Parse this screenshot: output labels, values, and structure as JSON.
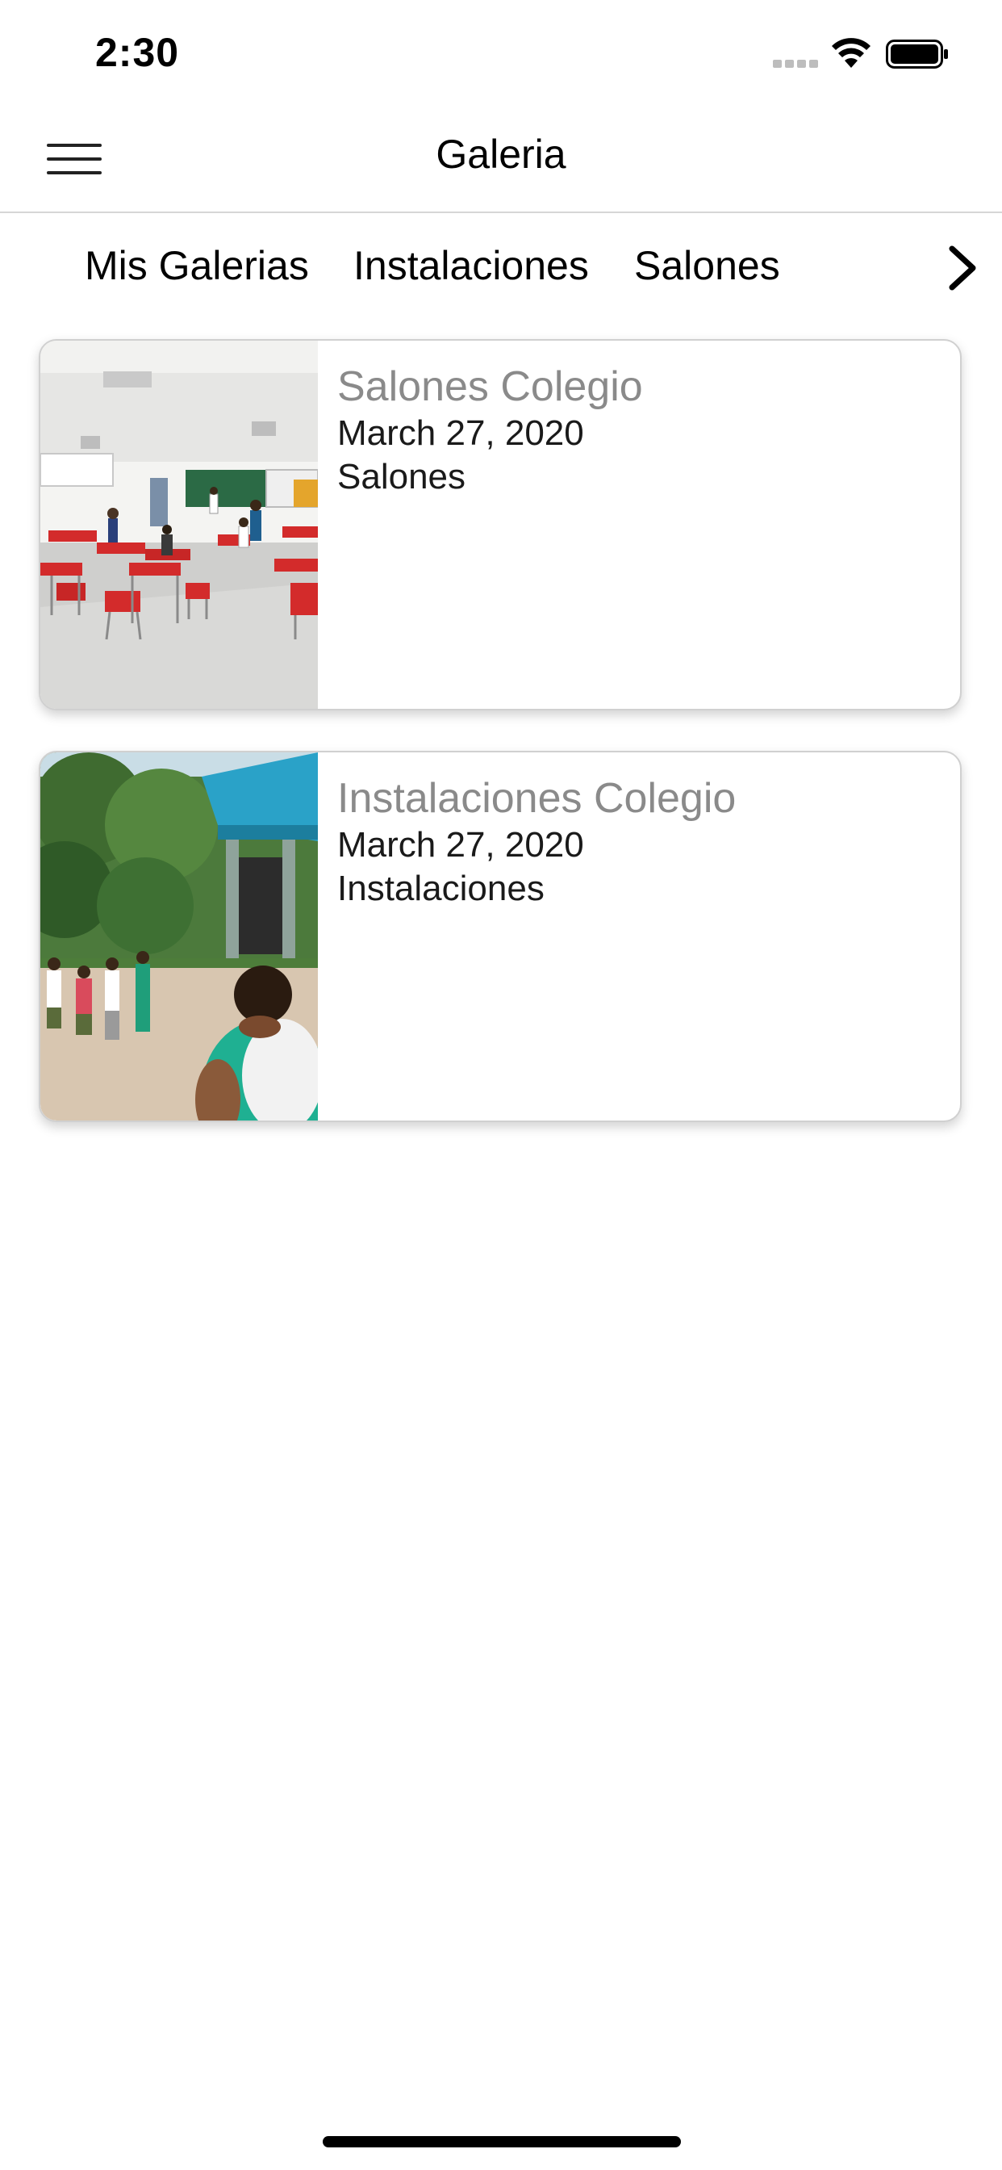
{
  "status_bar": {
    "time": "2:30"
  },
  "nav": {
    "title": "Galeria",
    "menu_icon": "hamburger-menu-icon"
  },
  "tabs": [
    {
      "label": "Mis Galerias"
    },
    {
      "label": "Instalaciones"
    },
    {
      "label": "Salones"
    }
  ],
  "tabs_next_icon": "chevron-right-icon",
  "galleries": [
    {
      "title": "Salones Colegio",
      "date": "March 27, 2020",
      "category": "Salones"
    },
    {
      "title": "Instalaciones Colegio",
      "date": "March 27, 2020",
      "category": "Instalaciones"
    }
  ]
}
